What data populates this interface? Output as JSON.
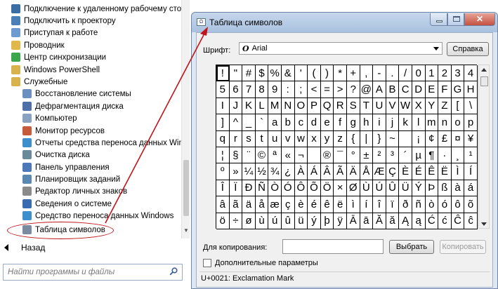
{
  "start_menu": {
    "items": [
      {
        "label": "Подключение к удаленному рабочему столу",
        "color": "#3a6ea5"
      },
      {
        "label": "Подключить к проектору",
        "color": "#4a7fb8"
      },
      {
        "label": "Приступая к работе",
        "color": "#6b9bd1"
      },
      {
        "label": "Проводник",
        "color": "#e0b84a"
      },
      {
        "label": "Центр синхронизации",
        "color": "#3aa84a"
      },
      {
        "label": "Windows PowerShell",
        "color": "#d8b24a"
      },
      {
        "label": "Служебные",
        "color": "#d8b24a"
      },
      {
        "label": "Восстановление системы",
        "color": "#6a8fc0"
      },
      {
        "label": "Дефрагментация диска",
        "color": "#4f6fa8"
      },
      {
        "label": "Компьютер",
        "color": "#8aa2c2"
      },
      {
        "label": "Монитор ресурсов",
        "color": "#c65a3a"
      },
      {
        "label": "Отчеты средства переноса данных Windows",
        "color": "#3f8fcf"
      },
      {
        "label": "Очистка диска",
        "color": "#6a8a9a"
      },
      {
        "label": "Панель управления",
        "color": "#4a78b8"
      },
      {
        "label": "Планировщик заданий",
        "color": "#5a88b0"
      },
      {
        "label": "Редактор личных знаков",
        "color": "#8a8a8a"
      },
      {
        "label": "Сведения о системе",
        "color": "#3a6ab0"
      },
      {
        "label": "Средство переноса данных Windows",
        "color": "#3f8fcf"
      },
      {
        "label": "Таблица символов",
        "color": "#7a8aa0"
      }
    ],
    "back_label": "Назад",
    "search_placeholder": "Найти программы и файлы"
  },
  "window": {
    "title": "Таблица символов",
    "font_label": "Шрифт:",
    "font_value": "Arial",
    "font_icon_glyph": "O",
    "help_label": "Справка",
    "copy_label": "Для копирования:",
    "copy_value": "",
    "select_label": "Выбрать",
    "copy_button_label": "Копировать",
    "advanced_label": "Дополнительные параметры",
    "status": "U+0021: Exclamation Mark",
    "close_glyph": "✕"
  },
  "char_grid": [
    "!\"#$%&'()*+,-./01234",
    "56789:;<=>?@ABCDEFGH",
    "IJKLMNOPQRSTUVWXYZ[\\",
    "]^_`abcdefghijklmnop",
    "qrstuvwxyz{|}~ ¡¢£¤¥",
    "¦§¨©ª«¬­®¯°±²³´µ¶·¸¹",
    "º»¼½¾¿ÀÁÂÃÄÅÆÇÈÉÊËÌÍ",
    "ÎÏÐÑÒÓÔÕÖ×ØÙÚÛÜÝÞßàá",
    "âãäåæçèéêëìíîïðñòóôõ",
    "ö÷øùúûüýþÿĀāĂăĄąĆćĈĉ"
  ],
  "selected_char": "!",
  "colors": {
    "annotation_red": "#c0141b",
    "window_border": "#6d86a8"
  }
}
